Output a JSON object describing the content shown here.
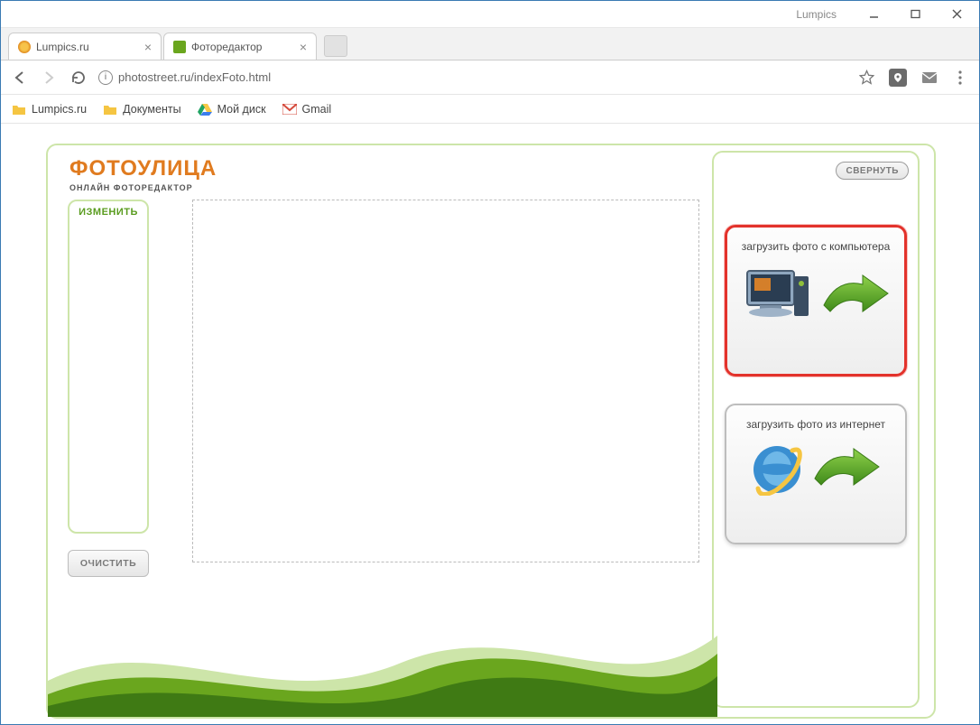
{
  "window": {
    "title": "Lumpics"
  },
  "tabs": [
    {
      "label": "Lumpics.ru",
      "active": false,
      "favicon": "#f5a623"
    },
    {
      "label": "Фоторедактор",
      "active": true,
      "favicon": "#6aa61e"
    }
  ],
  "address": {
    "url": "photostreet.ru/indexFoto.html"
  },
  "bookmarks": [
    {
      "label": "Lumpics.ru",
      "icon": "folder",
      "color": "#f5c542"
    },
    {
      "label": "Документы",
      "icon": "folder",
      "color": "#f5c542"
    },
    {
      "label": "Мой диск",
      "icon": "drive",
      "color": "#1fa463"
    },
    {
      "label": "Gmail",
      "icon": "gmail",
      "color": "#d54b3d"
    }
  ],
  "app": {
    "logo_main": "ФОТОУЛИЦА",
    "logo_sub": "ОНЛАЙН  ФОТОРЕДАКТОР",
    "left_label": "ИЗМЕНИТЬ",
    "clear_label": "ОЧИСТИТЬ",
    "collapse_label": "СВЕРНУТЬ",
    "upload_pc": "загрузить фото с компьютера",
    "upload_net": "загрузить фото из интернет"
  }
}
